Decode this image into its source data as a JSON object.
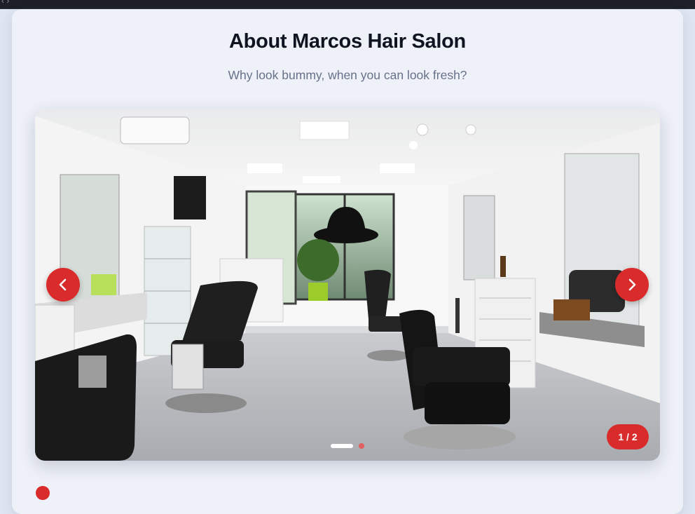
{
  "browser": {
    "crumb": "‹ ›"
  },
  "about": {
    "title": "About Marcos Hair Salon",
    "subtitle": "Why look bummy, when you can look fresh?"
  },
  "carousel": {
    "image_alt": "Barbershop interior with black barber chairs and mirrors",
    "current_slide": 1,
    "total_slides": 2,
    "counter": "1 / 2",
    "prev_icon": "chevron-left-icon",
    "next_icon": "chevron-right-icon"
  },
  "colors": {
    "accent": "#d92b2b",
    "title": "#0f1420",
    "subtitle": "#677189",
    "card_bg": "#eef1f8"
  },
  "next_section": {
    "heading_peek": ""
  }
}
